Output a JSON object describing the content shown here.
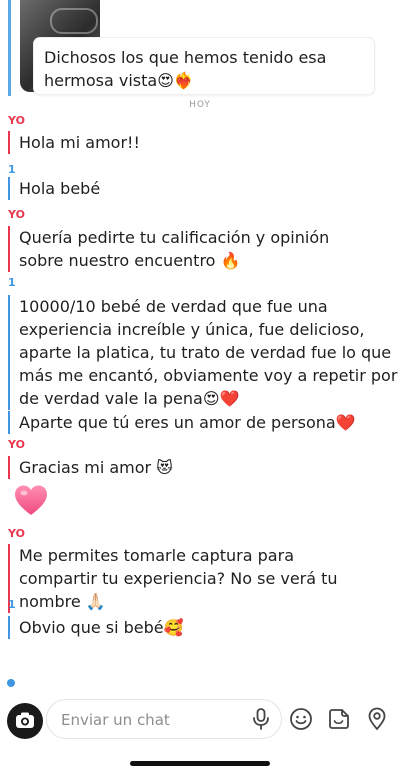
{
  "story": {
    "quote": "Dichosos los que hemos tenido esa hermosa vista😍❤️‍🔥"
  },
  "divider": "HOY",
  "senders": {
    "me": "YO",
    "other": "1"
  },
  "messages": [
    {
      "from": "me",
      "text": "Hola mi amor!!"
    },
    {
      "from": "other",
      "text": "Hola bebé"
    },
    {
      "from": "me",
      "text": "Quería pedirte tu calificación y opinión sobre nuestro encuentro 🔥"
    },
    {
      "from": "other",
      "text": "10000/10 bebé de verdad que fue una experiencia increíble y única, fue delicioso, aparte la platica, tu trato de verdad fue lo que más me encantó, obviamente voy a repetir por de verdad vale la pena😍❤️"
    },
    {
      "from": "other",
      "text": "Aparte que tú eres un amor de persona❤️"
    },
    {
      "from": "me",
      "text": "Gracias mi amor 😻"
    },
    {
      "from": "me",
      "text": "💗"
    },
    {
      "from": "me",
      "text": "Me permites tomarle captura para compartir tu experiencia? No se verá tu nombre 🙏🏻"
    },
    {
      "from": "other",
      "text": "Obvio que si bebé🥰"
    }
  ],
  "composer": {
    "placeholder": "Enviar un chat"
  },
  "colors": {
    "me_accent": "#e8364e",
    "other_accent": "#3e97e0"
  },
  "icons": [
    "camera-icon",
    "microphone-icon",
    "emoji-icon",
    "sticker-icon",
    "location-icon"
  ]
}
